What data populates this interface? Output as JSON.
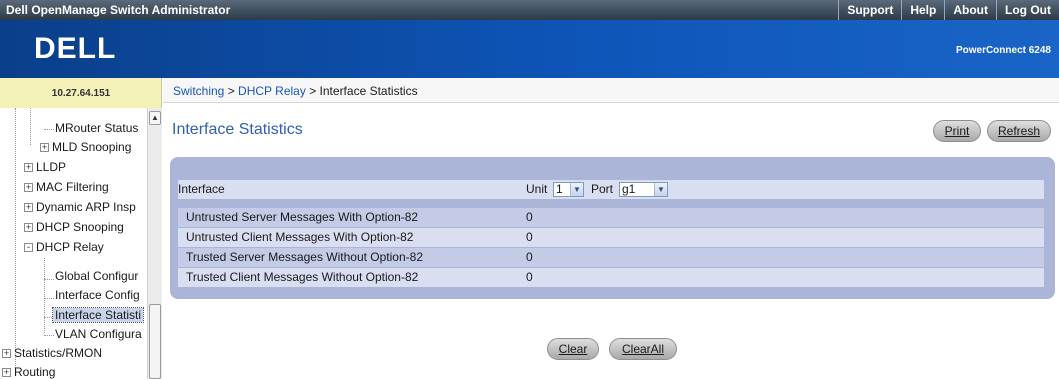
{
  "app": {
    "title": "Dell OpenManage Switch Administrator",
    "top_links": [
      "Support",
      "Help",
      "About",
      "Log Out"
    ],
    "brand": "DELL",
    "product": "PowerConnect 6248"
  },
  "sidebar": {
    "ip": "10.27.64.151",
    "items": [
      {
        "label": "MRouter Status",
        "level": 2
      },
      {
        "label": "MLD Snooping",
        "level": 1,
        "expander": "+"
      },
      {
        "label": "LLDP",
        "level": 0,
        "expander": "+"
      },
      {
        "label": "MAC Filtering",
        "level": 0,
        "expander": "+"
      },
      {
        "label": "Dynamic ARP Insp",
        "level": 0,
        "expander": "+"
      },
      {
        "label": "DHCP Snooping",
        "level": 0,
        "expander": "+"
      },
      {
        "label": "DHCP Relay",
        "level": 0,
        "expander": "-"
      },
      {
        "label": "Global Configur",
        "level": 1
      },
      {
        "label": "Interface Config",
        "level": 1
      },
      {
        "label": "Interface Statisti",
        "level": 1,
        "selected": true
      },
      {
        "label": "VLAN Configura",
        "level": 1
      },
      {
        "label": "Statistics/RMON",
        "level": -1,
        "expander": "+"
      },
      {
        "label": "Routing",
        "level": -1,
        "expander": "+"
      }
    ]
  },
  "breadcrumb": {
    "links": [
      "Switching",
      "DHCP Relay"
    ],
    "current": "Interface Statistics",
    "separator": " > "
  },
  "page": {
    "title": "Interface Statistics",
    "print_label": "Print",
    "refresh_label": "Refresh",
    "clear_label": "Clear",
    "clearall_label": "ClearAll"
  },
  "form": {
    "interface_label": "Interface",
    "unit_label": "Unit",
    "unit_value": "1",
    "port_label": "Port",
    "port_value": "g1"
  },
  "stats": [
    {
      "label": "Untrusted Server Messages With Option-82",
      "value": "0"
    },
    {
      "label": "Untrusted Client Messages With Option-82",
      "value": "0"
    },
    {
      "label": "Trusted Server Messages Without Option-82",
      "value": "0"
    },
    {
      "label": "Trusted Client Messages Without Option-82",
      "value": "0"
    }
  ],
  "colors": {
    "banner": "#0e55b8",
    "panel": "#abb5d8",
    "title": "#2f61b0",
    "link": "#1a56b3"
  }
}
